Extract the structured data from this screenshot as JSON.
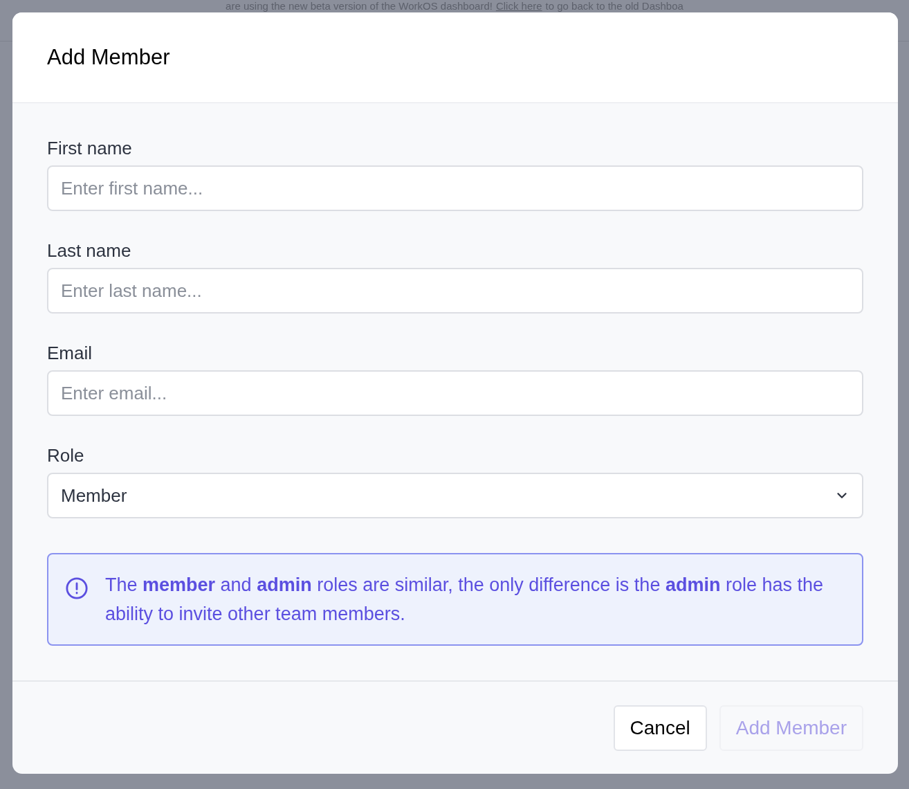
{
  "banner": {
    "text": "are using the new beta version of the WorkOS dashboard!",
    "link": "Click here",
    "text_after": "to go back to the old Dashboa"
  },
  "dialog": {
    "title": "Add Member",
    "fields": [
      {
        "kind": "text",
        "label": "First name",
        "placeholder": "Enter first name..."
      },
      {
        "kind": "text",
        "label": "Last name",
        "placeholder": "Enter last name..."
      },
      {
        "kind": "text",
        "label": "Email",
        "placeholder": "Enter email..."
      },
      {
        "kind": "select",
        "label": "Role",
        "value": "Member"
      }
    ],
    "notice": "The **member** and **admin** roles are similar, the only difference is the **admin** role has the ability to invite other team members.",
    "buttons": [
      {
        "label": "Cancel",
        "disabled": false
      },
      {
        "label": "Add Member",
        "disabled": true
      }
    ]
  }
}
